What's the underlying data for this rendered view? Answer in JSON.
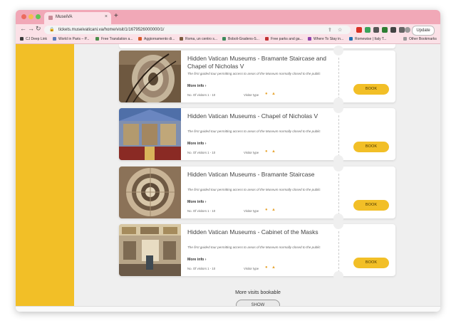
{
  "window": {
    "tab_title": "MuseiVA",
    "close_tab": "×",
    "new_tab": "+"
  },
  "toolbar": {
    "back": "←",
    "forward": "→",
    "reload": "↻",
    "url": "tickets.museivaticani.va/home/visit/1/1679526000000/1/",
    "update_label": "Update"
  },
  "bookmarks": [
    {
      "label": "CJ Deep Link",
      "color": "#3b3b3b"
    },
    {
      "label": "World in Paris – P...",
      "color": "#5b7db8"
    },
    {
      "label": "Free Translation a...",
      "color": "#4c8f4c"
    },
    {
      "label": "Aggiornamento di...",
      "color": "#d65a2a"
    },
    {
      "label": "Roma, un centro s...",
      "color": "#7a5c3e"
    },
    {
      "label": "Boboli-Gradens-S...",
      "color": "#3c8a5c"
    },
    {
      "label": "Free parks and ga...",
      "color": "#c23232"
    },
    {
      "label": "Where To Stay in...",
      "color": "#8e44ad"
    },
    {
      "label": "Romewise | Italy T...",
      "color": "#1f6fb2"
    }
  ],
  "other_bookmarks": "Other Bookmarks",
  "visits": [
    {
      "title": "Hidden Vatican Museums - Bramante Staircase and Chapel of Nicholas V",
      "description": "The first guided tour permitting access to areas of the Museum normally closed to the public",
      "more_info": "More info",
      "visitors": "No. Of visitors 1 - 10",
      "visitor_type": "Visitor type",
      "book": "BOOK"
    },
    {
      "title": "Hidden Vatican Museums - Chapel of Nicholas V",
      "description": "The first guided tour permitting access to areas of the Museum normally closed to the public",
      "more_info": "More info",
      "visitors": "No. Of visitors 1 - 10",
      "visitor_type": "Visitor type",
      "book": "BOOK"
    },
    {
      "title": "Hidden Vatican Museums - Bramante Staircase",
      "description": "The first guided tour permitting access to areas of the Museum normally closed to the public",
      "more_info": "More info",
      "visitors": "No. Of visitors 1 - 10",
      "visitor_type": "Visitor type",
      "book": "BOOK"
    },
    {
      "title": "Hidden Vatican Museums - Cabinet of the Masks",
      "description": "The first guided tour permitting access to areas of the Museum normally closed to the public",
      "more_info": "More info",
      "visitors": "No. Of visitors 1 - 10",
      "visitor_type": "Visitor type",
      "book": "BOOK"
    }
  ],
  "more_visits": "More visits bookable",
  "show_button": "SHOW",
  "colors": {
    "accent": "#f2bf27",
    "chrome_tab_bar": "#f1a8b7",
    "chrome_toolbar": "#fbe1e7"
  }
}
